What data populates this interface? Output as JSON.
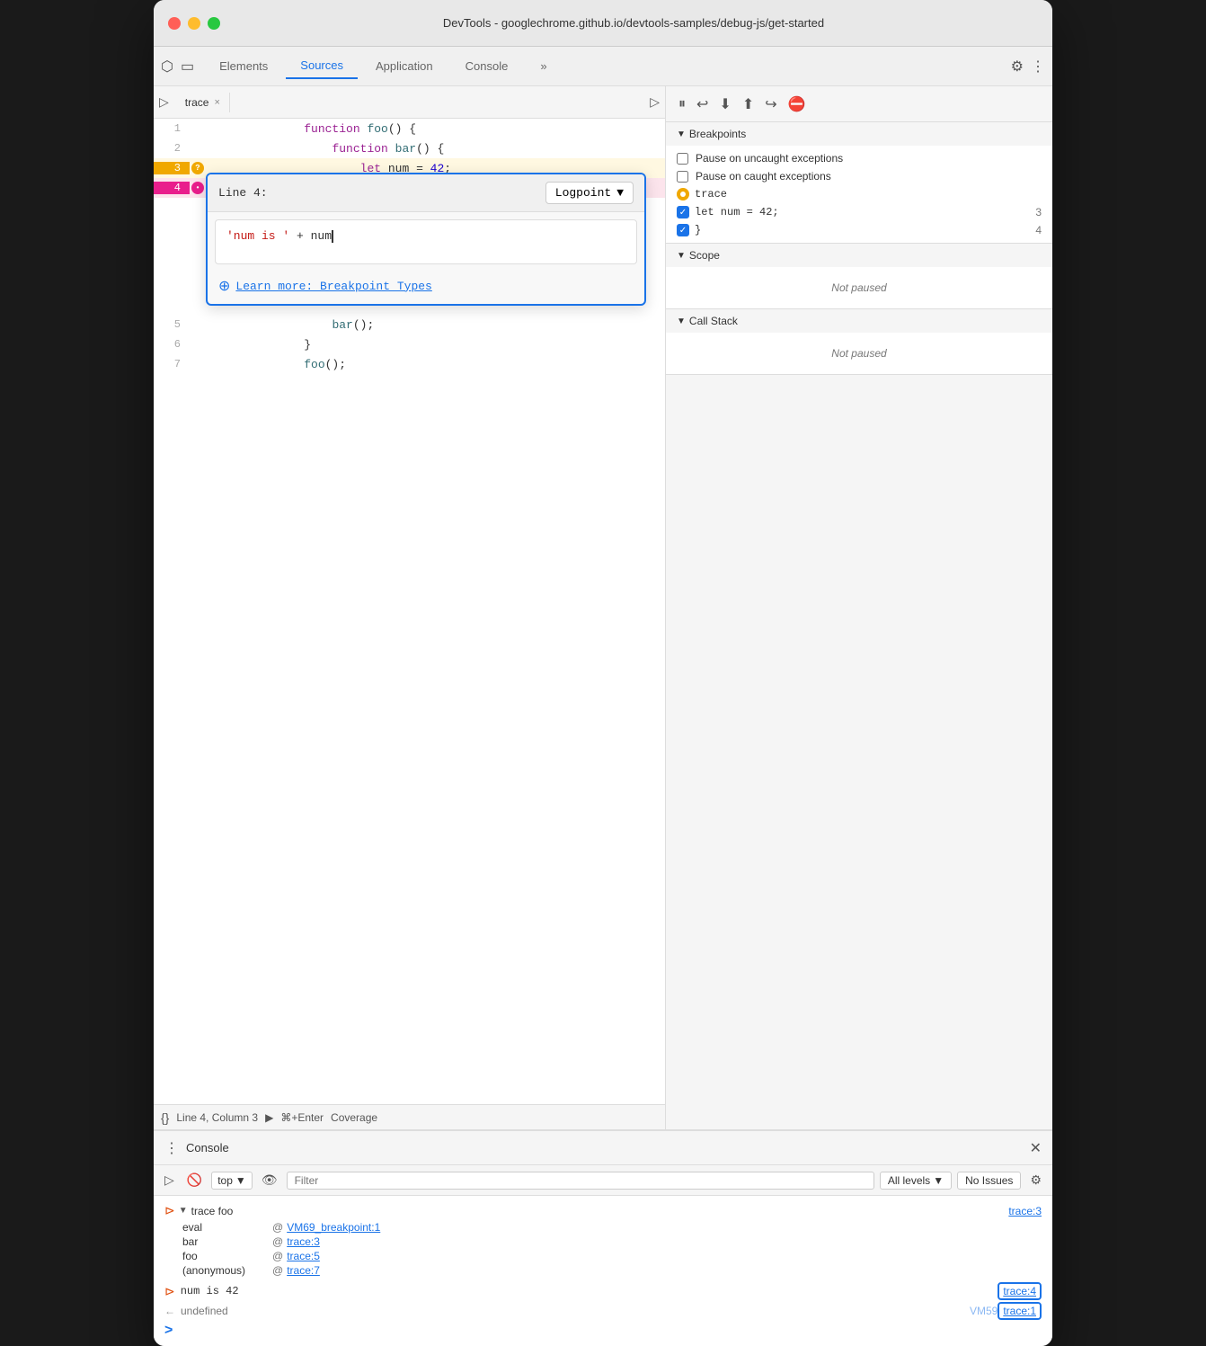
{
  "window": {
    "title": "DevTools - googlechrome.github.io/devtools-samples/debug-js/get-started"
  },
  "tabs": {
    "elements": "Elements",
    "sources": "Sources",
    "application": "Application",
    "console": "Console",
    "more": "»"
  },
  "file_tab": {
    "name": "trace",
    "close": "×"
  },
  "code": {
    "lines": [
      {
        "num": "1",
        "content": "function foo() {",
        "gutter": ""
      },
      {
        "num": "2",
        "content": "    function bar() {",
        "gutter": ""
      },
      {
        "num": "3",
        "content": "        let num = 42;",
        "gutter": "question"
      },
      {
        "num": "4",
        "content": "    }",
        "gutter": "dot"
      },
      {
        "num": "5",
        "content": "    bar();",
        "gutter": ""
      },
      {
        "num": "6",
        "content": "}",
        "gutter": ""
      },
      {
        "num": "7",
        "content": "foo();",
        "gutter": ""
      }
    ]
  },
  "logpoint": {
    "line_label": "Line 4:",
    "type": "Logpoint",
    "input_text": "'num is ' + num",
    "learn_more_text": "Learn more: Breakpoint Types"
  },
  "status_bar": {
    "position": "Line 4, Column 3",
    "run_label": "⌘+Enter",
    "coverage": "Coverage"
  },
  "debugger": {
    "controls": [
      "⏸",
      "⟳",
      "⬇",
      "⬆",
      "↪",
      "⛔"
    ]
  },
  "breakpoints": {
    "section_title": "Breakpoints",
    "pause_uncaught": "Pause on uncaught exceptions",
    "pause_caught": "Pause on caught exceptions",
    "items": [
      {
        "label": "trace",
        "type": "orange",
        "line": ""
      },
      {
        "label": "let num = 42;",
        "type": "checkbox",
        "line": "3"
      },
      {
        "label": "}",
        "type": "checkbox",
        "line": "4"
      }
    ]
  },
  "scope": {
    "title": "Scope",
    "not_paused": "Not paused"
  },
  "callstack": {
    "title": "Call Stack",
    "not_paused": "Not paused"
  },
  "console_panel": {
    "title": "Console",
    "toolbar": {
      "top": "top",
      "filter_placeholder": "Filter",
      "all_levels": "All levels",
      "no_issues": "No Issues"
    },
    "output": [
      {
        "type": "trace_group",
        "icon": "▶",
        "header": "trace foo",
        "link": "trace:3",
        "rows": [
          {
            "label": "eval",
            "at": "@",
            "link": "VM69_breakpoint:1"
          },
          {
            "label": "bar",
            "at": "@",
            "link": "trace:3"
          },
          {
            "label": "foo",
            "at": "@",
            "link": "trace:5"
          },
          {
            "label": "(anonymous)",
            "at": "@",
            "link": "trace:7"
          }
        ]
      },
      {
        "type": "result",
        "icon": "⊳",
        "text": "num is 42",
        "link": "trace:4",
        "boxed": true
      },
      {
        "type": "undefined",
        "icon": "←",
        "text": "undefined",
        "link": "VM59_trace:1"
      }
    ],
    "prompt": ">"
  }
}
